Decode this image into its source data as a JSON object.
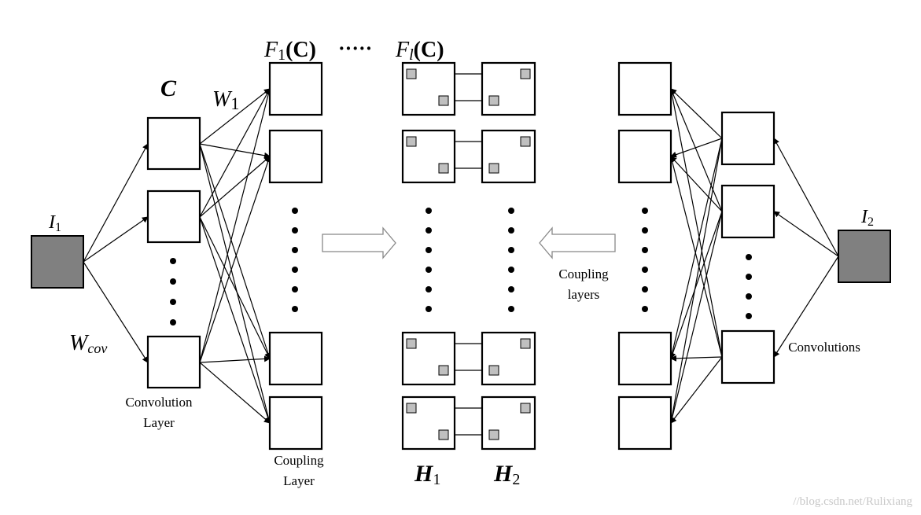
{
  "labels": {
    "i1": "I",
    "i1_sub": "1",
    "i2": "I",
    "i2_sub": "2",
    "c": "C",
    "w1": "W",
    "w1_sub": "1",
    "wcov": "W",
    "wcov_sub": "cov",
    "f1": "F",
    "f1_sub": "1",
    "f1_arg": "(C)",
    "f_dots": "·····",
    "fl": "F",
    "fl_sub": "l",
    "fl_arg": "(C)",
    "convolution_layer_1": "Convolution",
    "convolution_layer_2": "Layer",
    "coupling_layer_1": "Coupling",
    "coupling_layer_2": "Layer",
    "h1": "H",
    "h1_sub": "1",
    "h2": "H",
    "h2_sub": "2",
    "coupling_layers_1": "Coupling",
    "coupling_layers_2": "layers",
    "convolutions": "Convolutions",
    "watermark": "//blog.csdn.net/Rulixiang"
  },
  "colors": {
    "input_fill": "#808080",
    "feature_point": "#c0c0c0"
  }
}
